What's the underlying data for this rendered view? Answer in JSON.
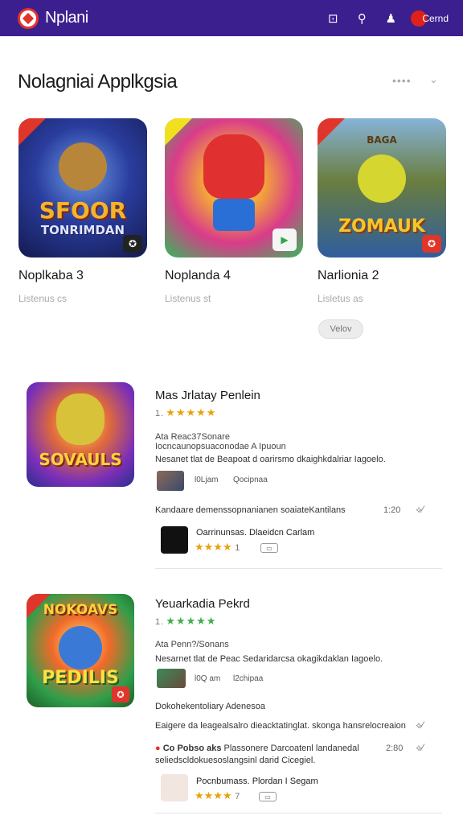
{
  "appbar": {
    "app_name": "Nplani",
    "user_label": "Cernd",
    "icons": [
      "controller-icon",
      "search-icon",
      "bell-icon",
      "avatar"
    ]
  },
  "section": {
    "title": "Nolagniai Applkgsia",
    "more": "••••",
    "chevron": "⌄"
  },
  "cards": [
    {
      "art_text_1": "SFOOR",
      "art_text_2": "TONRIMDAN",
      "name": "Noplkaba 3",
      "sub": "Listenus cs"
    },
    {
      "art_text_1": "",
      "art_text_2": "",
      "name": "Noplanda 4",
      "sub": "Listenus st"
    },
    {
      "art_text_1": "BAGA",
      "art_text_2": "ZOMAUK",
      "name": "Narlionia 2",
      "sub": "Lisletus as"
    }
  ],
  "more_button": "Velov",
  "featured": [
    {
      "art_text": "SOVAULS",
      "title": "Mas Jrlatay Penlein",
      "rating": "1.",
      "stars": "★★★★★",
      "meta": "Ata Reac37Sonare",
      "meta2": "Iocncaunopsuaconodae A Ipuoun",
      "desc": "Nesanet tlat de Beapoat d oarirsmo dkaighkdalriar Iagoelo.",
      "thumb_time": "l0Ljam",
      "thumb_info": "Qocipnaa",
      "review": "Kandaare demenssopnanianen soaiateKantilans",
      "review_num": "1:20",
      "dev_name": "Oarrinunsas. Dlaeidcn Carlam",
      "dev_stars": "★★★★",
      "dev_rating": "1"
    },
    {
      "art_text": "NOKOAVS",
      "art_text_2": "PEDILIS",
      "title": "Yeuarkadia Pekrd",
      "rating": "1.",
      "stars": "★★★★★",
      "meta": "Ata Penn?/Sonans",
      "desc": "Nesarnet tlat de Peac Sedaridarcsa okagikdaklan Iagoelo.",
      "thumb_time": "l0Q am",
      "thumb_info": "l2chipaa",
      "review_label": "Dokohekentoliary Adenesoa",
      "review": "Eaigere da leagealsalro dieacktatinglat. skonga hansrelocreaion",
      "review_num_2": "",
      "review2_prefix": "Co Pobso aks",
      "review2": "Plassonere Darcoatenl landanedal",
      "review2_line2": "seliedscldokuesoslangsinl darid Cicegiel.",
      "review_num": "2:80",
      "dev_name": "Pocnbumass. Plordan I Segam",
      "dev_stars": "★★★★",
      "dev_rating": "7"
    }
  ]
}
